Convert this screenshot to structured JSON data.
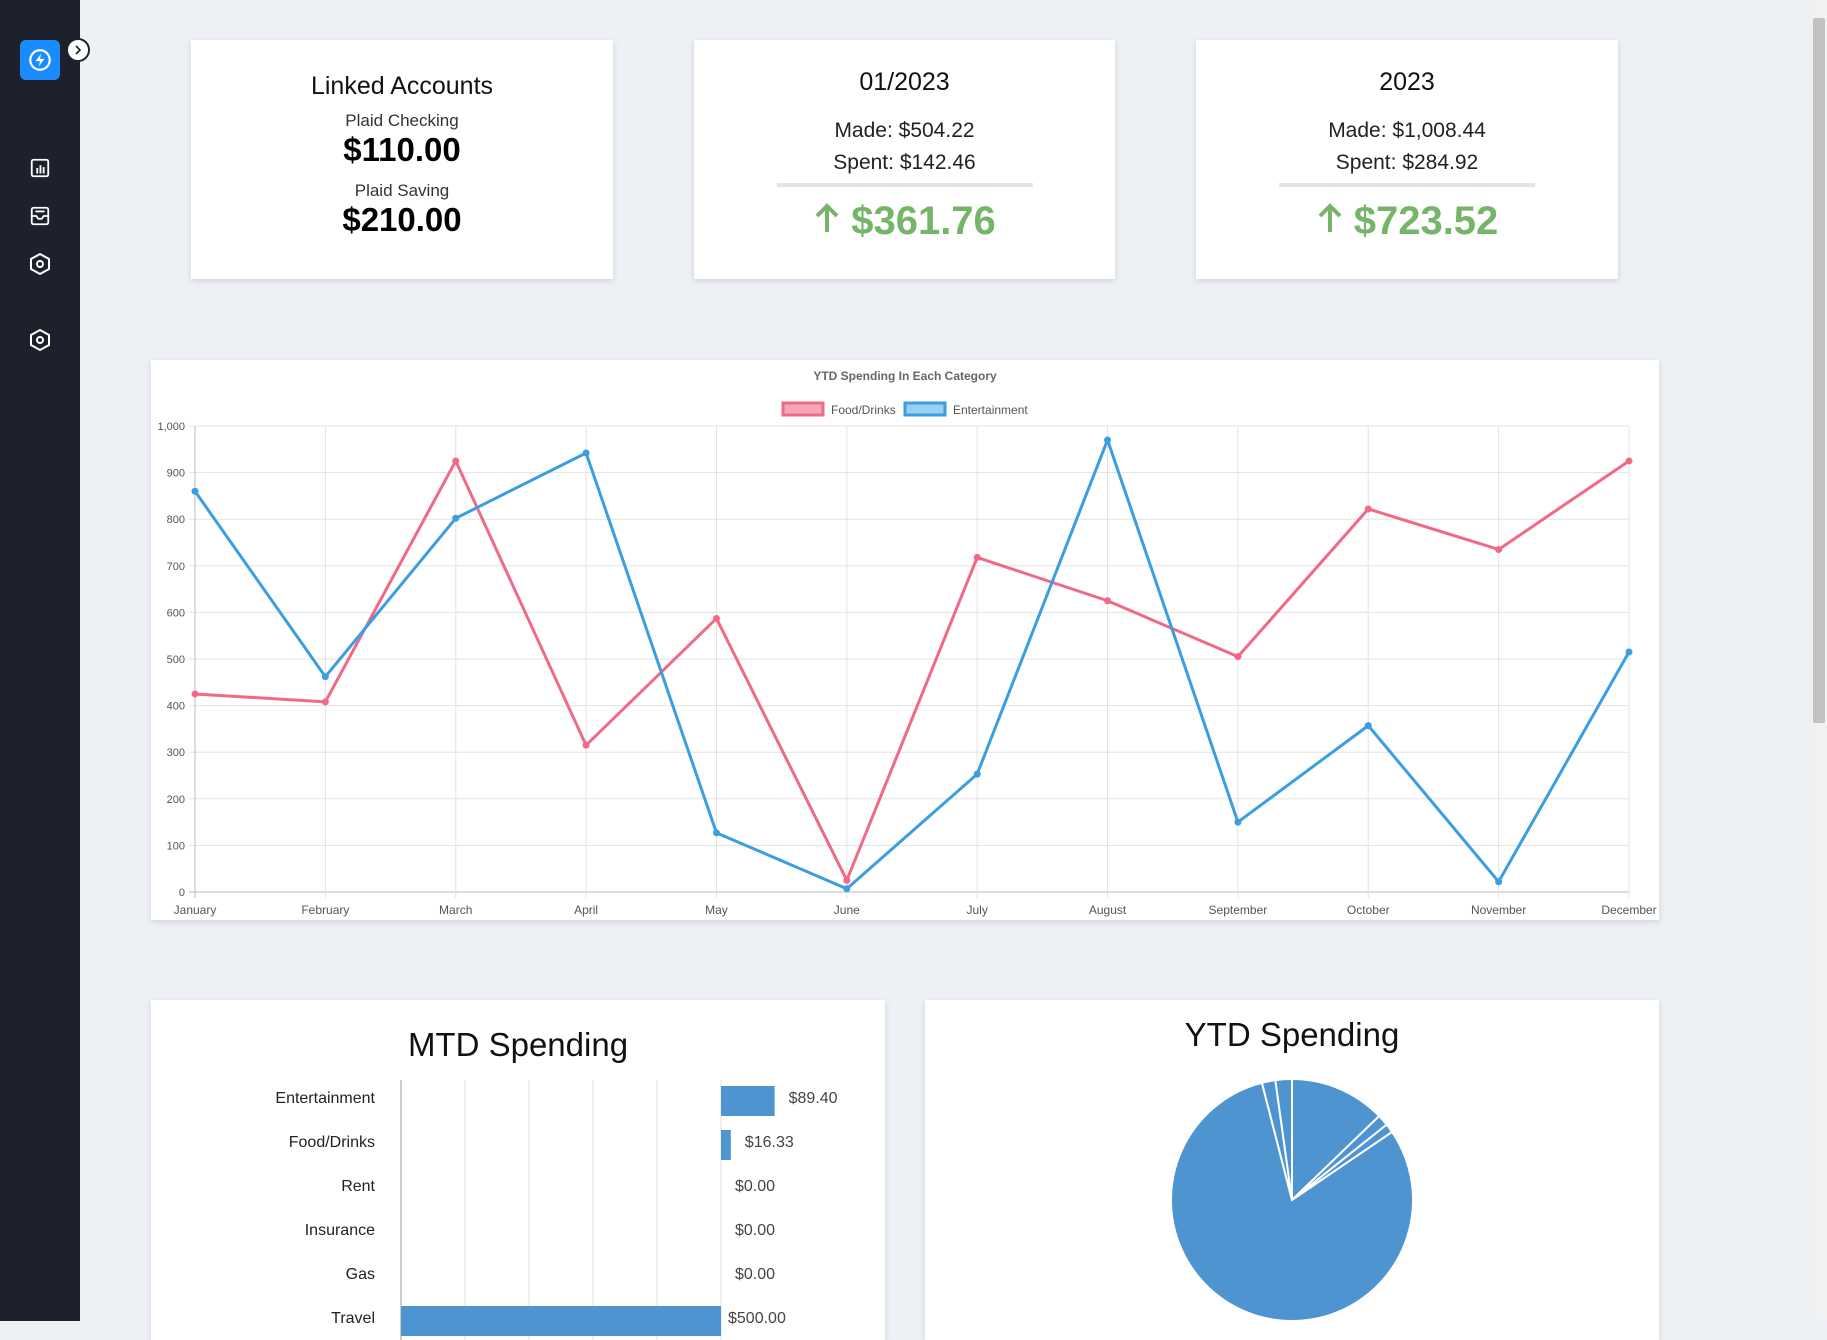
{
  "sidebar": {
    "logo_icon": "bolt-icon",
    "expand_icon": "chevron-right-icon",
    "items": [
      {
        "icon": "bar-chart-icon"
      },
      {
        "icon": "inbox-icon"
      },
      {
        "icon": "hexagon-settings-icon"
      },
      {
        "icon": "hexagon-settings-icon"
      }
    ]
  },
  "accounts_card": {
    "title": "Linked Accounts",
    "accounts": [
      {
        "name": "Plaid Checking",
        "balance": "$110.00"
      },
      {
        "name": "Plaid Saving",
        "balance": "$210.00"
      }
    ]
  },
  "month_card": {
    "title": "01/2023",
    "made": "Made: $504.22",
    "spent": "Spent: $142.46",
    "net": "$361.76",
    "net_icon": "arrow-up-icon"
  },
  "year_card": {
    "title": "2023",
    "made": "Made: $1,008.44",
    "spent": "Spent: $284.92",
    "net": "$723.52",
    "net_icon": "arrow-up-icon"
  },
  "colors": {
    "accent": "#1a8cff",
    "positive": "#76b469",
    "food": "#f06a87",
    "entertainment": "#3b9ee0",
    "bar": "#4d94d0"
  },
  "ytd_category_chart": {
    "chart_data": {
      "type": "line",
      "title": "YTD Spending In Each Category",
      "x": [
        "January",
        "February",
        "March",
        "April",
        "May",
        "June",
        "July",
        "August",
        "September",
        "October",
        "November",
        "December"
      ],
      "series": [
        {
          "name": "Food/Drinks",
          "values": [
            425,
            408,
            925,
            315,
            587,
            25,
            718,
            625,
            505,
            822,
            735,
            925
          ]
        },
        {
          "name": "Entertainment",
          "values": [
            860,
            462,
            802,
            942,
            127,
            7,
            253,
            970,
            150,
            357,
            22,
            515
          ]
        }
      ],
      "ylim": [
        0,
        1000
      ],
      "yticks": [
        "0",
        "100",
        "200",
        "300",
        "400",
        "500",
        "600",
        "700",
        "800",
        "900",
        "1,000"
      ],
      "grid": true,
      "legend": "top"
    }
  },
  "mtd_chart": {
    "title": "MTD Spending",
    "chart_data": {
      "type": "bar",
      "categories": [
        "Entertainment",
        "Food/Drinks",
        "Rent",
        "Insurance",
        "Gas",
        "Travel"
      ],
      "values": [
        89.4,
        16.33,
        0,
        0,
        0,
        500.0
      ],
      "value_labels": [
        "$89.40",
        "$16.33",
        "$0.00",
        "$0.00",
        "$0.00",
        "$500.00"
      ]
    }
  },
  "ytd_pie": {
    "title": "YTD Spending",
    "chart_data": {
      "type": "pie",
      "values": [
        12.8,
        1.5,
        1.2,
        80.5,
        1.8,
        2.2
      ]
    }
  }
}
